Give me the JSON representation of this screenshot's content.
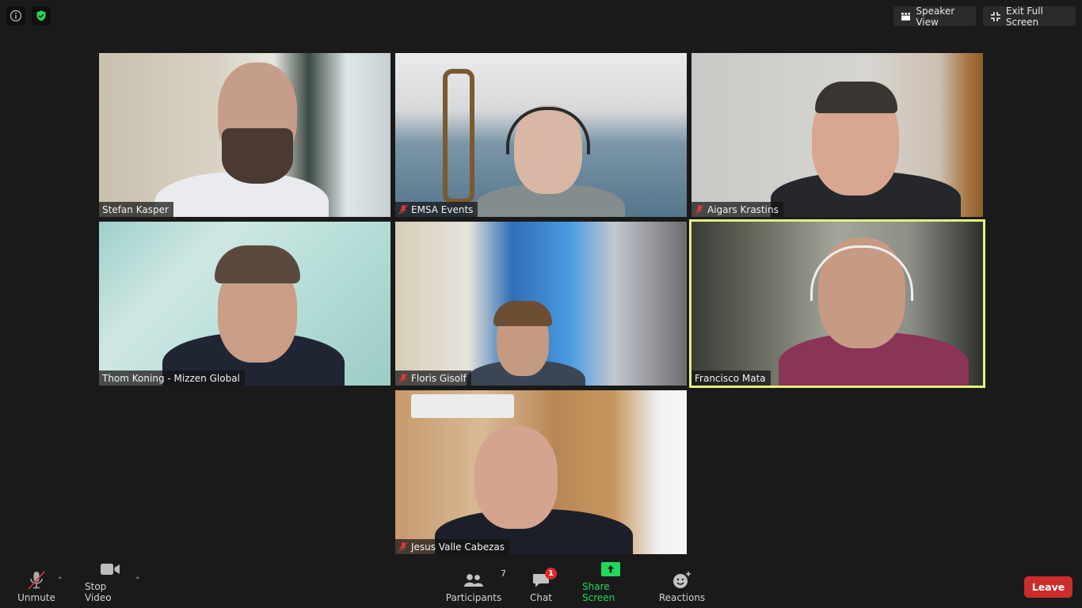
{
  "top_left": {
    "info_icon": "info-icon",
    "security_icon": "shield-check-icon",
    "security_color": "#23d959"
  },
  "top_right": {
    "speaker_view": {
      "label": "Speaker View",
      "icon": "speaker-view-icon"
    },
    "exit_full_screen": {
      "label": "Exit Full Screen",
      "icon": "collapse-icon"
    }
  },
  "participants": [
    {
      "name": "Stefan Kasper",
      "muted": false,
      "active": false
    },
    {
      "name": "EMSA Events",
      "muted": true,
      "active": false
    },
    {
      "name": "Aigars Krastins",
      "muted": true,
      "active": false
    },
    {
      "name": "Thom Koning - Mizzen Global",
      "muted": false,
      "active": false
    },
    {
      "name": "Floris Gisolf",
      "muted": true,
      "active": false
    },
    {
      "name": "Francisco Mata",
      "muted": false,
      "active": true
    },
    {
      "name": "Jesus Valle Cabezas",
      "muted": true,
      "active": false
    }
  ],
  "toolbar": {
    "unmute": {
      "label": "Unmute",
      "icon": "microphone-muted-icon"
    },
    "stop_video": {
      "label": "Stop Video",
      "icon": "video-camera-icon"
    },
    "participants": {
      "label": "Participants",
      "count": "7",
      "icon": "participants-icon"
    },
    "chat": {
      "label": "Chat",
      "badge": "1",
      "icon": "chat-icon"
    },
    "share_screen": {
      "label": "Share Screen",
      "icon": "share-screen-icon",
      "color": "#23d959"
    },
    "reactions": {
      "label": "Reactions",
      "icon": "reactions-icon"
    },
    "leave": {
      "label": "Leave",
      "color": "#cc2c2c"
    }
  },
  "colors": {
    "active_speaker_border": "#e6f07a",
    "muted_icon": "#e0393e"
  }
}
